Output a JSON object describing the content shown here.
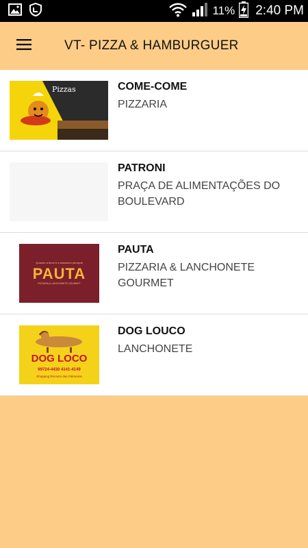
{
  "status_bar": {
    "battery_percent": "11%",
    "time": "2:40 PM"
  },
  "app_bar": {
    "title": "VT- PIZZA & HAMBURGUER"
  },
  "restaurants": [
    {
      "name": "COME-COME",
      "description": "PIZZARIA",
      "logo_text": "Pizzas"
    },
    {
      "name": "PATRONI",
      "description": "PRAÇA DE ALIMENTAÇÕES DO BOULEVARD"
    },
    {
      "name": "PAUTA",
      "description": "PIZZARIA & LANCHONETE GOURMET",
      "logo_text": "PAUTA",
      "logo_tagline": "Quando a fome é a acessório principal",
      "logo_subtitle": "PIZZARIA & LANCHONETE GOURMET"
    },
    {
      "name": "DOG LOUCO",
      "description": "LANCHONETE",
      "logo_text": "DOG LOCO",
      "logo_phone": "99724-4430  4141-4149",
      "logo_address": "Shopping Recanto das Palmeiras"
    }
  ]
}
